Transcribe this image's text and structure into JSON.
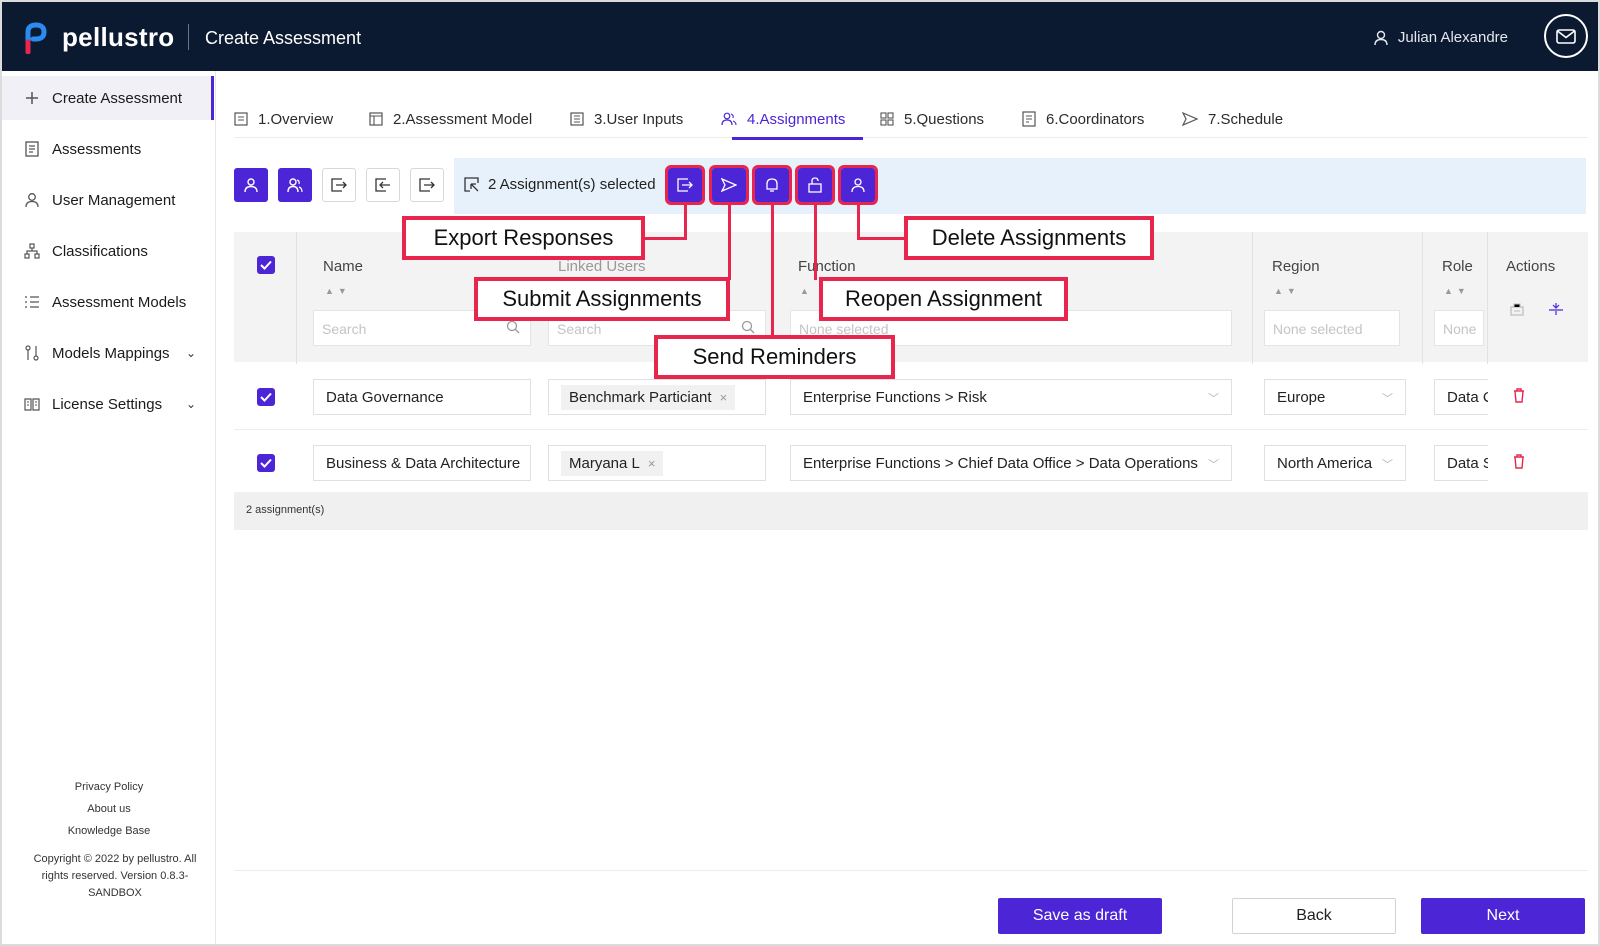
{
  "app": {
    "brand": "pellustro",
    "page_title": "Create Assessment",
    "user_name": "Julian Alexandre"
  },
  "sidebar": {
    "items": [
      {
        "label": "Create Assessment",
        "icon": "plus-icon",
        "active": true
      },
      {
        "label": "Assessments",
        "icon": "assessments-icon"
      },
      {
        "label": "User Management",
        "icon": "user-icon"
      },
      {
        "label": "Classifications",
        "icon": "hierarchy-icon"
      },
      {
        "label": "Assessment Models",
        "icon": "list-icon"
      },
      {
        "label": "Models Mappings",
        "icon": "mapping-icon",
        "expandable": true
      },
      {
        "label": "License Settings",
        "icon": "book-icon",
        "expandable": true
      }
    ],
    "footer_links": [
      "Privacy Policy",
      "About us",
      "Knowledge Base"
    ],
    "copyright": "Copyright © 2022 by pellustro. All rights reserved. Version 0.8.3-SANDBOX"
  },
  "tabs": [
    {
      "label": "1.Overview",
      "icon": "document-icon"
    },
    {
      "label": "2.Assessment Model",
      "icon": "layout-icon"
    },
    {
      "label": "3.User Inputs",
      "icon": "form-icon"
    },
    {
      "label": "4.Assignments",
      "icon": "users-icon",
      "active": true
    },
    {
      "label": "5.Questions",
      "icon": "grid-icon"
    },
    {
      "label": "6.Coordinators",
      "icon": "checklist-icon"
    },
    {
      "label": "7.Schedule",
      "icon": "send-icon"
    }
  ],
  "toolbar": {
    "selection_text": "2 Assignment(s) selected"
  },
  "callouts": {
    "export": "Export Responses",
    "submit": "Submit Assignments",
    "send_reminders": "Send Reminders",
    "reopen": "Reopen Assignment",
    "delete": "Delete Assignments"
  },
  "table": {
    "columns": {
      "name": "Name",
      "linked_users": "Linked Users",
      "function": "Function",
      "region": "Region",
      "role": "Role",
      "actions": "Actions"
    },
    "filters": {
      "name_placeholder": "Search",
      "users_placeholder": "Search",
      "function_placeholder": "None selected",
      "region_placeholder": "None selected",
      "role_placeholder": "None"
    },
    "rows": [
      {
        "name": "Data Governance",
        "user": "Benchmark Particiant",
        "function": "Enterprise Functions > Risk",
        "region": "Europe",
        "role": "Data C"
      },
      {
        "name": "Business & Data Architecture",
        "user": "Maryana L",
        "function": "Enterprise Functions > Chief Data Office > Data Operations",
        "region": "North America",
        "role": "Data S"
      }
    ],
    "footer": "2 assignment(s)"
  },
  "buttons": {
    "save_draft": "Save as draft",
    "back": "Back",
    "next": "Next"
  },
  "colors": {
    "accent": "#4b25d6",
    "callout": "#e8264d",
    "topbar": "#0b1a30",
    "selection_bar": "#e6f1fb"
  }
}
